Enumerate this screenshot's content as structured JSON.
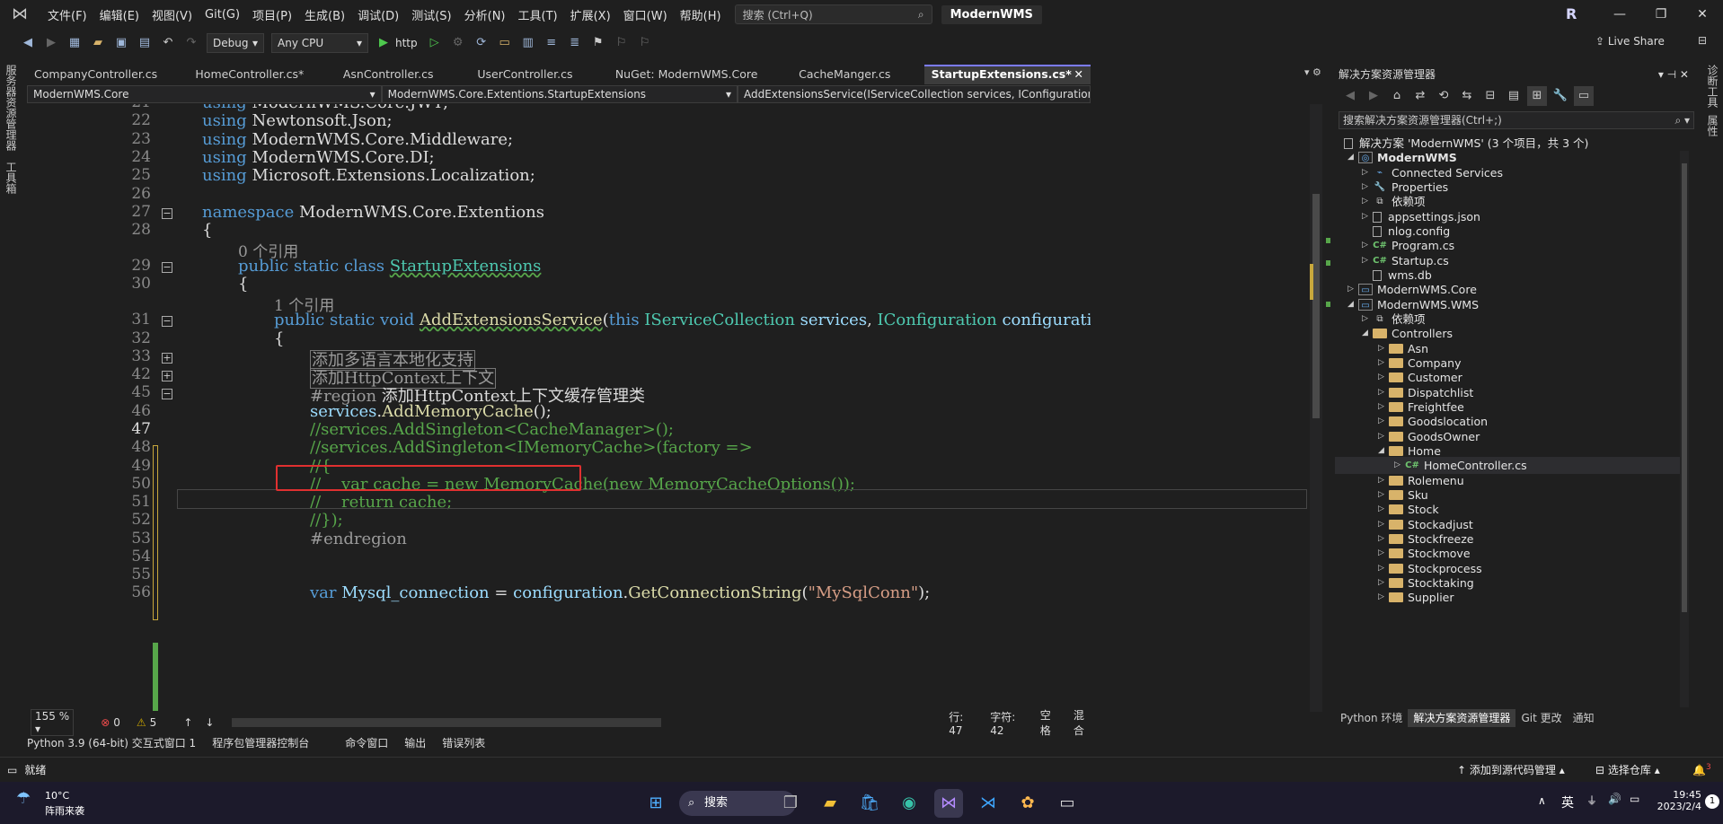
{
  "menu": {
    "items": [
      "文件(F)",
      "编辑(E)",
      "视图(V)",
      "Git(G)",
      "项目(P)",
      "生成(B)",
      "调试(D)",
      "测试(S)",
      "分析(N)",
      "工具(T)",
      "扩展(X)",
      "窗口(W)",
      "帮助(H)"
    ],
    "search_placeholder": "搜索 (Ctrl+Q)",
    "project_name": "ModernWMS",
    "avatar": "R"
  },
  "toolbar": {
    "config": "Debug",
    "platform": "Any CPU",
    "run_target": "http",
    "live_share": "Live Share"
  },
  "left_strip": [
    "服务器资源管理器",
    "工具箱"
  ],
  "right_strip": [
    "诊断工具",
    "属性"
  ],
  "tabs": [
    {
      "label": "CompanyController.cs"
    },
    {
      "label": "HomeController.cs*"
    },
    {
      "label": "AsnController.cs"
    },
    {
      "label": "UserController.cs"
    },
    {
      "label": "NuGet: ModernWMS.Core"
    },
    {
      "label": "CacheManger.cs"
    },
    {
      "label": "StartupExtensions.cs*"
    }
  ],
  "navbar": {
    "project": "ModernWMS.Core",
    "class": "ModernWMS.Core.Extentions.StartupExtensions",
    "member": "AddExtensionsService(IServiceCollection services, IConfiguration configurati"
  },
  "code": {
    "line_numbers": [
      "22",
      "23",
      "24",
      "25",
      "26",
      "27",
      "28",
      "",
      "29",
      "30",
      "",
      "31",
      "32",
      "33",
      "42",
      "45",
      "46",
      "47",
      "48",
      "49",
      "50",
      "51",
      "52",
      "53",
      "54",
      "55",
      "56"
    ],
    "l22_kw": "using",
    "l22": "Newtonsoft.Json;",
    "l23_kw": "using",
    "l23": "ModernWMS.Core.Middleware;",
    "l24_kw": "using",
    "l24": "ModernWMS.Core.DI;",
    "l25_kw": "using",
    "l25": "Microsoft.Extensions.Localization;",
    "l27_kw": "namespace",
    "l27": "ModernWMS.Core.Extentions",
    "l28": "{",
    "ref_class": "0 个引用",
    "l29_kw": "public static class",
    "l29_name": "StartupExtensions",
    "l30": "{",
    "ref_method": "1 个引用",
    "l31_kw": "public static void",
    "l31_name": "AddExtensionsService",
    "l31_open": "(",
    "l31_this": "this",
    "l31_t1": "IServiceCollection",
    "l31_p1": "services",
    "l31_comma": ",",
    "l31_t2": "IConfiguration",
    "l31_p2": "configuration",
    "l31_close": ")",
    "l32": "{",
    "l33": "添加多语言本地化支持",
    "l42": "添加HttpContext上下文",
    "l45_kw": "#region",
    "l45": "添加HttpContext上下文缓存管理类",
    "l46_p": "services",
    "l46_dot": ".",
    "l46_fn": "AddMemoryCache",
    "l46_end": "();",
    "l47": "//services.AddSingleton<CacheManager>();",
    "l48": "//services.AddSingleton<IMemoryCache>(factory =>",
    "l49": "//{",
    "l50": "//    var cache = new MemoryCache(new MemoryCacheOptions());",
    "l51": "//    return cache;",
    "l52": "//});",
    "l53": "#endregion",
    "l56_kw": "var",
    "l56_p": "Mysql_connection",
    "l56_eq": " = ",
    "l56_p2": "configuration",
    "l56_dot": ".",
    "l56_fn": "GetConnectionString",
    "l56_o": "(",
    "l56_s": "\"MySqlConn\"",
    "l56_c": ");"
  },
  "editor_status": {
    "zoom": "155 %",
    "errors": "0",
    "warnings": "5",
    "line": "行: 47",
    "col": "字符: 42",
    "space": "空格",
    "eol": "混合"
  },
  "solution_explorer": {
    "title": "解决方案资源管理器",
    "search": "搜索解决方案资源管理器(Ctrl+;)",
    "nodes": [
      {
        "label": "解决方案 'ModernWMS' (3 个项目，共 3 个)",
        "icon": "solution",
        "bold": false
      },
      {
        "label": "ModernWMS",
        "icon": "project",
        "bold": true
      },
      {
        "label": "Connected Services",
        "icon": "connected"
      },
      {
        "label": "Properties",
        "icon": "properties"
      },
      {
        "label": "依赖项",
        "icon": "dependencies"
      },
      {
        "label": "appsettings.json",
        "icon": "json"
      },
      {
        "label": "nlog.config",
        "icon": "config"
      },
      {
        "label": "Program.cs",
        "icon": "cs"
      },
      {
        "label": "Startup.cs",
        "icon": "cs"
      },
      {
        "label": "wms.db",
        "icon": "db"
      },
      {
        "label": "ModernWMS.Core",
        "icon": "project"
      },
      {
        "label": "ModernWMS.WMS",
        "icon": "project"
      },
      {
        "label": "依赖项",
        "icon": "dependencies"
      },
      {
        "label": "Controllers",
        "icon": "folder"
      },
      {
        "label": "Asn",
        "icon": "folder"
      },
      {
        "label": "Company",
        "icon": "folder"
      },
      {
        "label": "Customer",
        "icon": "folder"
      },
      {
        "label": "Dispatchlist",
        "icon": "folder"
      },
      {
        "label": "Freightfee",
        "icon": "folder"
      },
      {
        "label": "Goodslocation",
        "icon": "folder"
      },
      {
        "label": "GoodsOwner",
        "icon": "folder"
      },
      {
        "label": "Home",
        "icon": "folder"
      },
      {
        "label": "HomeController.cs",
        "icon": "cs"
      },
      {
        "label": "Rolemenu",
        "icon": "folder"
      },
      {
        "label": "Sku",
        "icon": "folder"
      },
      {
        "label": "Stock",
        "icon": "folder"
      },
      {
        "label": "Stockadjust",
        "icon": "folder"
      },
      {
        "label": "Stockfreeze",
        "icon": "folder"
      },
      {
        "label": "Stockmove",
        "icon": "folder"
      },
      {
        "label": "Stockprocess",
        "icon": "folder"
      },
      {
        "label": "Stocktaking",
        "icon": "folder"
      },
      {
        "label": "Supplier",
        "icon": "folder"
      }
    ],
    "bottom_tabs": [
      "Python 环境",
      "解决方案资源管理器",
      "Git 更改",
      "通知"
    ]
  },
  "output_tabs": [
    "Python 3.9 (64-bit) 交互式窗口 1",
    "程序包管理器控制台",
    "命令窗口",
    "输出",
    "错误列表"
  ],
  "status": {
    "ready": "就绪",
    "source_control": "添加到源代码管理",
    "repo": "选择仓库",
    "notifications": "3"
  },
  "taskbar": {
    "weather_temp": "10°C",
    "weather_desc": "阵雨来袭",
    "search": "搜索",
    "ime": "英",
    "time": "19:45",
    "date": "2023/2/4",
    "badge": "1"
  },
  "colors": {
    "highlight_box": "#e03030",
    "keyword": "#569cd6",
    "type": "#4ec9b0",
    "comment": "#57a64a"
  }
}
